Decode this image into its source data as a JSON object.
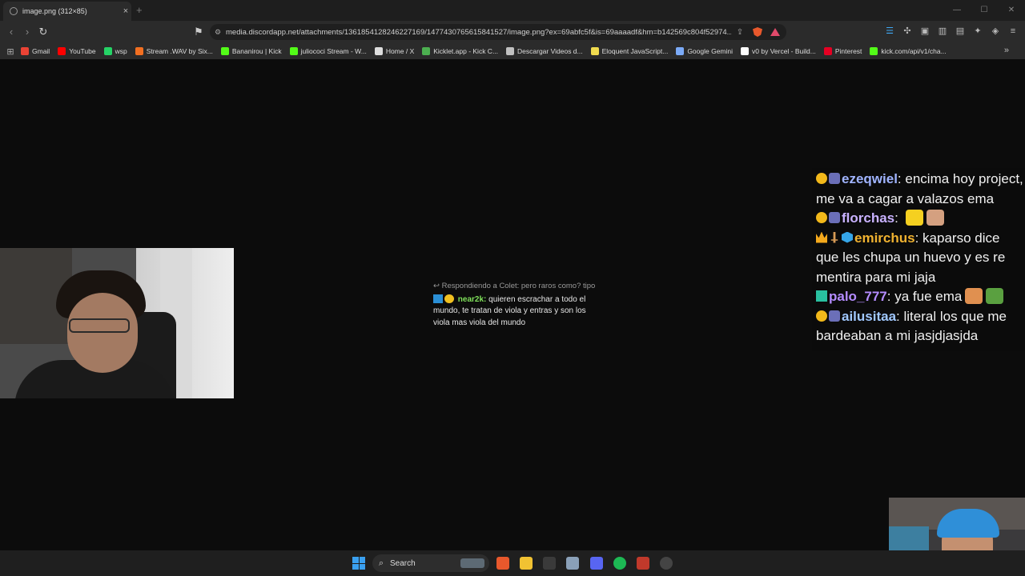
{
  "browser": {
    "tab_title": "image.png (312×85)",
    "url": "media.discordapp.net/attachments/1361854128246227169/1477430765615841527/image.png?ex=69abfc5f&is=69aaaadf&hm=b142569c804f52974...",
    "bookmarks": [
      {
        "label": "Gmail",
        "color": "#ea4335"
      },
      {
        "label": "YouTube",
        "color": "#ff0000"
      },
      {
        "label": "wsp",
        "color": "#25d366"
      },
      {
        "label": "Stream .WAV by Six...",
        "color": "#f26f21"
      },
      {
        "label": "Bananirou | Kick",
        "color": "#53fc18"
      },
      {
        "label": "juliococi Stream - W...",
        "color": "#53fc18"
      },
      {
        "label": "Home / X",
        "color": "#dddddd"
      },
      {
        "label": "Kicklet.app - Kick C...",
        "color": "#4caf50"
      },
      {
        "label": "Descargar Videos d...",
        "color": "#c0c0c0"
      },
      {
        "label": "Eloquent JavaScript...",
        "color": "#f0db4f"
      },
      {
        "label": "Google Gemini",
        "color": "#7baaf7"
      },
      {
        "label": "v0 by Vercel - Build...",
        "color": "#ffffff"
      },
      {
        "label": "Pinterest",
        "color": "#e60023"
      },
      {
        "label": "kick.com/api/v1/cha...",
        "color": "#53fc18"
      }
    ]
  },
  "reply_message": {
    "reply_to": "Respondiendo a Colet: pero raros como? tipo",
    "username": "near2k",
    "text": " quieren escrachar a todo el mundo, te tratan de viola y entras y son los viola mas viola del mundo"
  },
  "chat": [
    {
      "badges": [
        "num",
        "bot"
      ],
      "username": "ezeqwiel",
      "color": "#a0b4ff",
      "text": " encima hoy project, me va a cagar a valazos ema",
      "emotes": []
    },
    {
      "badges": [
        "num",
        "bot"
      ],
      "username": "florchas",
      "color": "#c9b2ff",
      "text": " ",
      "emotes": [
        "#f5d020",
        "#d4a080"
      ]
    },
    {
      "badges": [
        "crown",
        "sword",
        "cube"
      ],
      "username": "emirchus",
      "color": "#f0b230",
      "text": " kaparso dice que les chupa un huevo y es re mentira para mi jaja",
      "emotes": []
    },
    {
      "badges": [
        "grid"
      ],
      "username": "palo_777",
      "color": "#b48cff",
      "text": " ya fue ema",
      "emotes": [
        "#e09050",
        "#5aa040"
      ]
    },
    {
      "badges": [
        "num",
        "bot"
      ],
      "username": "ailusitaa",
      "color": "#a0c8ff",
      "text": " literal los que me bardeaban a mi jasjdjasjda",
      "emotes": []
    }
  ],
  "taskbar": {
    "search_label": "Search"
  }
}
